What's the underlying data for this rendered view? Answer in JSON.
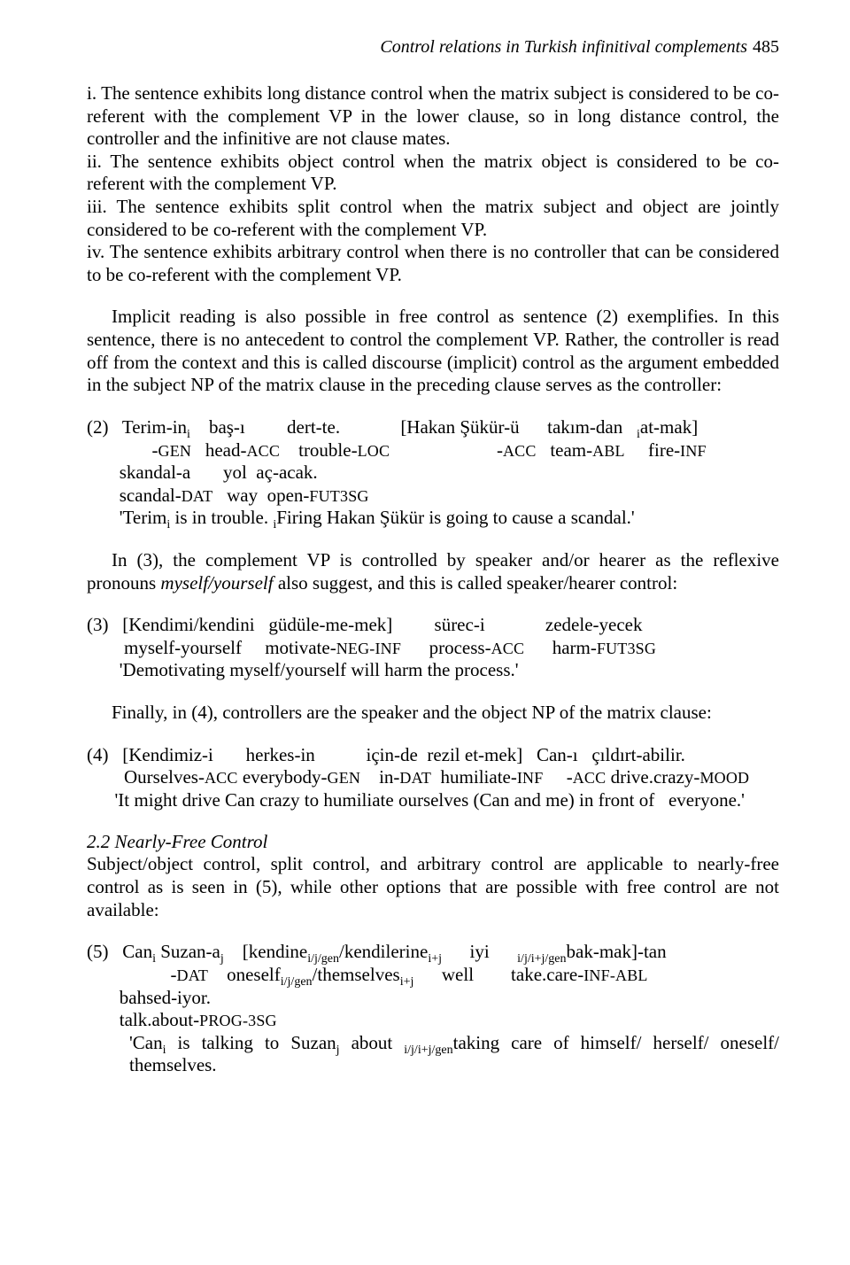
{
  "header": {
    "running_title": "Control relations in Turkish infinitival complements",
    "page_number": "485"
  },
  "list": {
    "i": "i. The sentence exhibits long distance control when the matrix subject is considered to be co-referent with the complement VP in the lower clause, so in long distance control, the controller and the infinitive are not clause mates.",
    "ii": "ii. The sentence exhibits object control when the matrix object is considered to be co-referent with the complement VP.",
    "iii": "iii. The sentence exhibits split control when the matrix subject and object are jointly considered to be co-referent with the complement VP.",
    "iv": "iv. The sentence exhibits arbitrary control when there is no controller that can be considered to be co-referent with the complement VP."
  },
  "para1": "Implicit reading is also possible in free control as sentence (2) exemplifies. In this sentence, there is no antecedent to control the complement VP. Rather, the controller is read off from the context and this is called discourse (implicit) control as the argument embedded in the subject NP of the matrix clause in the preceding clause serves as the controller:",
  "ex2": {
    "num": "(2)",
    "turk_l1_a": "Terim-in",
    "turk_l1_b": "baş-ı",
    "turk_l1_c": "dert-te.",
    "turk_l1_d": "[Hakan Şükür-ü",
    "turk_l1_e": "takım-dan",
    "turk_l1_f": "at-mak]",
    "gloss_l1_a_gen": "GEN",
    "gloss_l1_b_pre": "head-",
    "gloss_l1_b_acc": "ACC",
    "gloss_l1_c_pre": "trouble-",
    "gloss_l1_c_loc": "LOC",
    "gloss_l1_d_acc": "ACC",
    "gloss_l1_e_pre": "team-",
    "gloss_l1_e_abl": "ABL",
    "gloss_l1_f_pre": "fire-",
    "gloss_l1_f_inf": "INF",
    "turk_l2_a": "skandal-a",
    "turk_l2_b": "yol  aç-acak.",
    "gloss_l2_a_pre": "scandal-",
    "gloss_l2_a_dat": "DAT",
    "gloss_l2_b_pre": "way  open-",
    "gloss_l2_b_fut": "FUT3SG",
    "trans_a": "'Terim",
    "trans_b": " is in trouble. ",
    "trans_c": "Firing Hakan Şükür is going to cause a scandal.'"
  },
  "para2_a": "In (3), the complement VP is controlled by speaker and/or hearer as the reflexive pronouns ",
  "para2_b": "myself/yourself",
  "para2_c": " also suggest, and this is called speaker/hearer control:",
  "ex3": {
    "num": "(3)",
    "turk_a": "[Kendimi/kendini",
    "turk_b": "güdüle-me-mek]",
    "turk_c": "sürec-i",
    "turk_d": "zedele-yecek",
    "gloss_a": "myself-yourself",
    "gloss_b_pre": "motivate-",
    "gloss_b_neg": "NEG-INF",
    "gloss_c_pre": "process-",
    "gloss_c_acc": "ACC",
    "gloss_d_pre": "harm-",
    "gloss_d_fut": "FUT3SG",
    "trans": "'Demotivating myself/yourself will harm the process.'"
  },
  "para3": "Finally, in (4), controllers are the speaker and the object NP of the matrix clause:",
  "ex4": {
    "num": "(4)",
    "turk_a": "[Kendimiz-i",
    "turk_b": "herkes-in",
    "turk_c": "için-de  rezil et-mek]",
    "turk_d": "Can-ı",
    "turk_e": "çıldırt-abilir.",
    "gloss_a_pre": "Ourselves-",
    "gloss_a_acc": "ACC",
    "gloss_b_pre": " everybody-",
    "gloss_b_gen": "GEN",
    "gloss_c_pre": "in-",
    "gloss_c_dat": "DAT",
    "gloss_c_mid": "  humiliate-",
    "gloss_c_inf": "INF",
    "gloss_d_acc": "ACC",
    "gloss_e_pre": " drive.crazy-",
    "gloss_e_mood": "MOOD",
    "trans": "'It might drive Can crazy to humiliate ourselves (Can and me) in front of   everyone.'"
  },
  "section22": "2.2 Nearly-Free Control",
  "para4": "Subject/object control, split control, and arbitrary control are applicable to nearly-free control as is seen in (5), while other options that are possible with free control are not available:",
  "ex5": {
    "num": "(5)",
    "turk_a": "Can",
    "turk_b": " Suzan-a",
    "turk_c": "[kendine",
    "turk_d": "/kendilerine",
    "turk_e": "iyi",
    "turk_f": "bak-mak]-tan",
    "gloss_b_dat": "DAT",
    "gloss_c_pre": "oneself",
    "gloss_d_pre": "/themselves",
    "gloss_e": "well",
    "gloss_f_pre": "take.care-",
    "gloss_f_infabl": "INF-ABL",
    "turk2_a": "bahsed-iyor.",
    "gloss2_a_pre": "talk.about-",
    "gloss2_a_prog": "PROG-3SG",
    "trans_a": "'Can",
    "trans_b": " is talking to Suzan",
    "trans_c": " about ",
    "trans_d": "taking care of himself/ herself/ oneself/ themselves."
  },
  "subs": {
    "i": "i",
    "j": "j",
    "iplus": "i+j",
    "ijgen": "i/j/gen",
    "ijijgen": "i/j/i+j/gen"
  }
}
